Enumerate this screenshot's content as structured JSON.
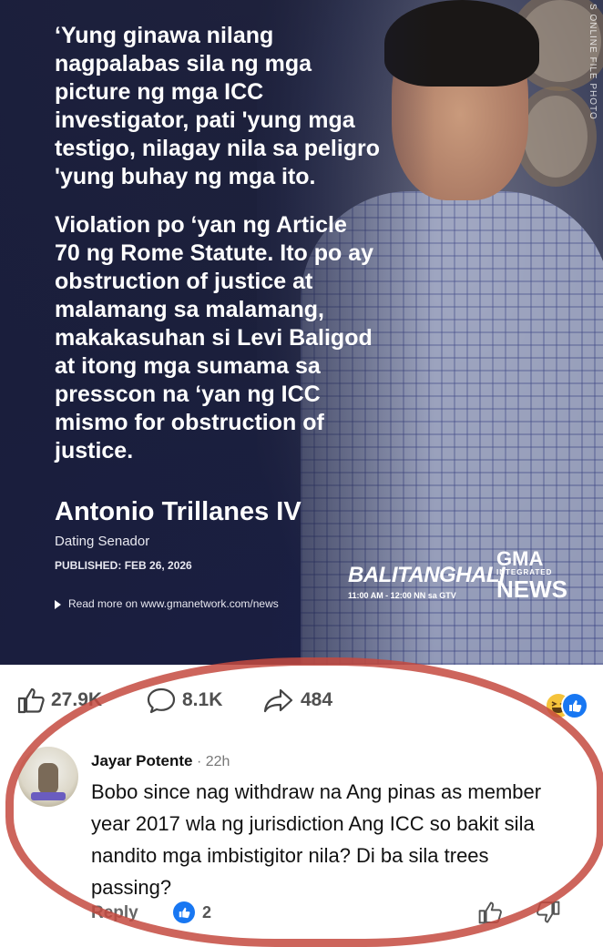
{
  "post": {
    "photo_credit": "S ONLINE FILE PHOTO",
    "quote_paragraphs": [
      "‘Yung ginawa nilang\nnagpalabas sila ng mga\npicture ng mga ICC\ninvestigator, pati 'yung mga\ntestigo, nilagay nila sa peligro\n'yung buhay ng mga ito.",
      "Violation po ‘yan ng Article\n70 ng Rome Statute. Ito po ay\nobstruction of justice at\nmalamang sa malamang,\nmakakasuhan si Levi Baligod\nat itong mga sumama sa\npresscon na ‘yan ng ICC\nmismo for obstruction of\njustice."
    ],
    "speaker": "Antonio Trillanes IV",
    "role": "Dating Senador",
    "published_label": "PUBLISHED:",
    "published_date": "FEB 26, 2026",
    "read_more": "Read more on www.gmanetwork.com/news",
    "show_name": "BALITANGHALI",
    "show_time": "11:00 AM - 12:00 NN sa GTV",
    "brand_top": "GMA",
    "brand_sub": "INTEGRATED",
    "brand_news": "NEWS"
  },
  "stats": {
    "likes": "27.9K",
    "comments": "8.1K",
    "shares": "484",
    "reaction_icons": [
      "haha-icon",
      "like-icon"
    ]
  },
  "comment": {
    "author": "Jayar Potente",
    "time": " · 22h",
    "text": "Bobo since nag withdraw na Ang pinas as member year 2017 wla ng jurisdiction Ang ICC so bakit sila nandito mga imbistigitor nila? Di ba sila trees passing?",
    "reply_label": "Reply",
    "like_count": "2"
  },
  "colors": {
    "accent": "#1877f2",
    "annotation_circle": "#c44a40",
    "card_bg": "#1b2148"
  }
}
